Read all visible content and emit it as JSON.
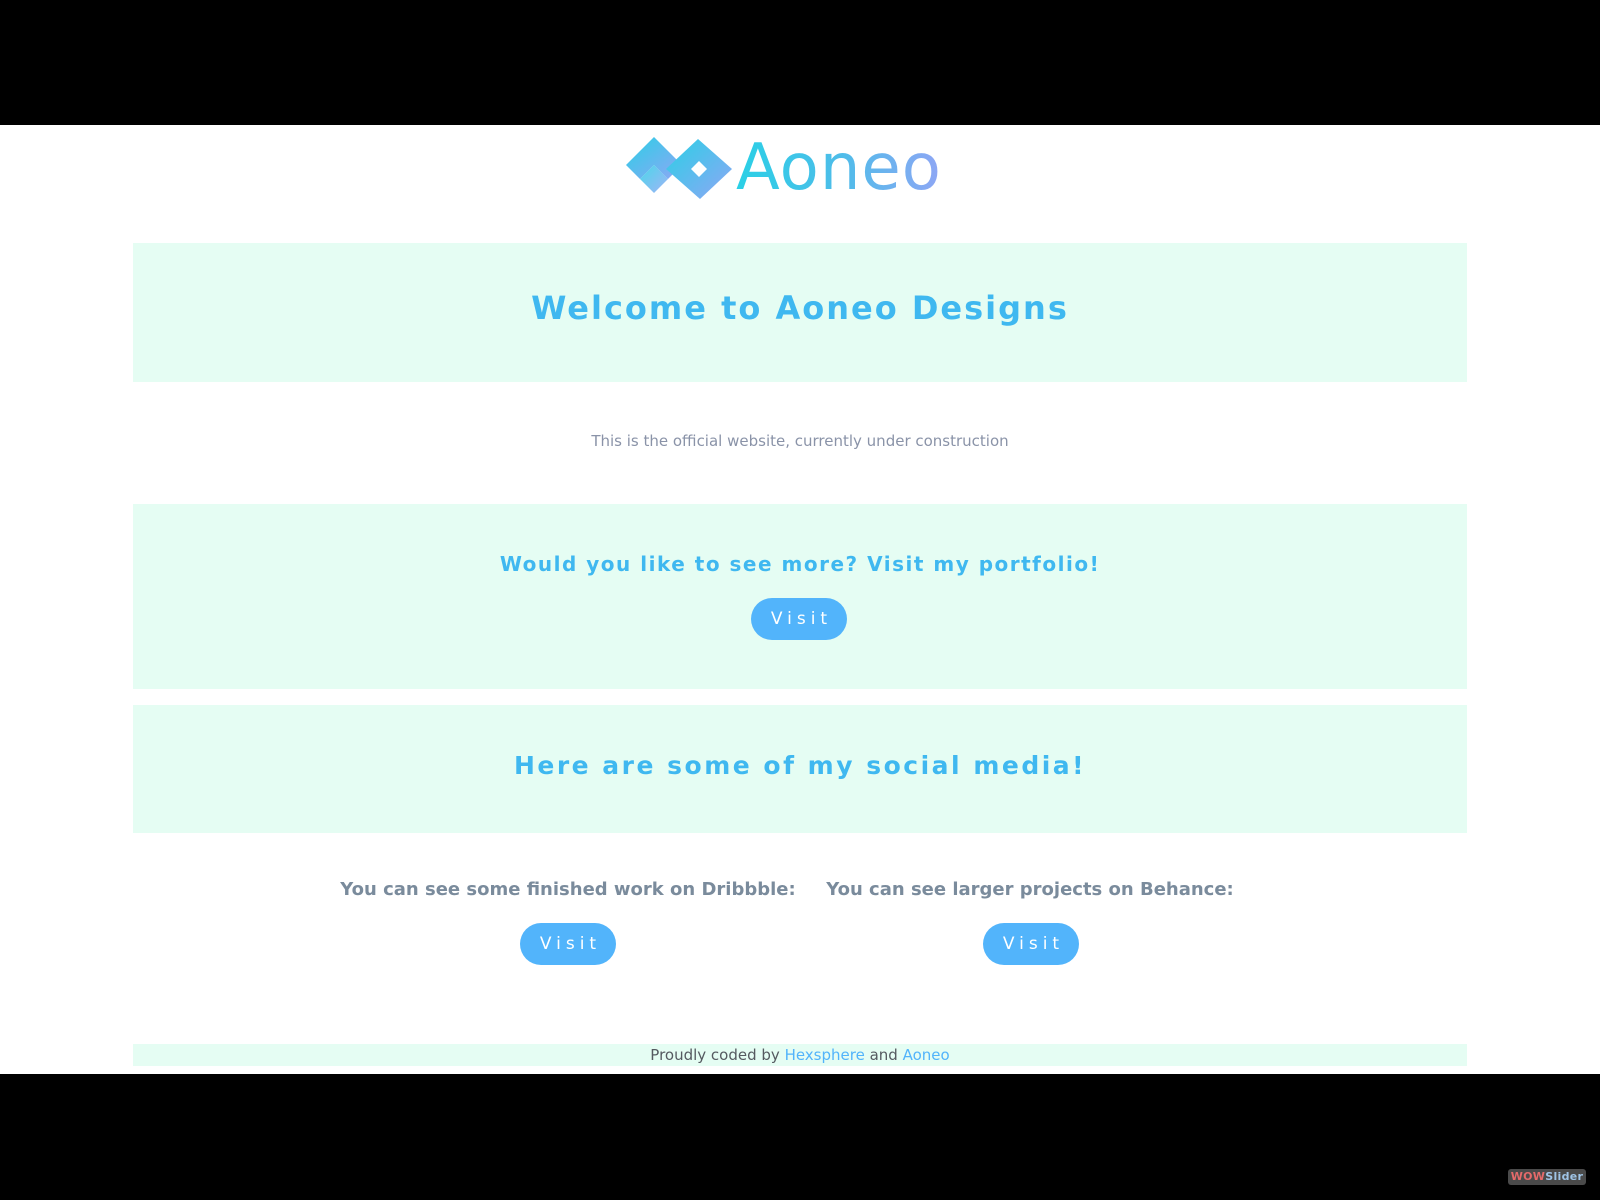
{
  "brand": {
    "name": "Aoneo",
    "gradient_start": "#2ad0e6",
    "gradient_end": "#8fa6f5"
  },
  "hero": {
    "title": "Welcome to Aoneo Designs"
  },
  "subtitle": "This is the official website, currently under construction",
  "portfolio": {
    "title": "Would you like to see more? Visit my portfolio!",
    "button_label": "Visit"
  },
  "social": {
    "title": "Here are some of my social media!",
    "dribbble": {
      "text": "You can see some finished work on Dribbble:",
      "button_label": "Visit"
    },
    "behance": {
      "text": "You can see larger projects on Behance:",
      "button_label": "Visit"
    }
  },
  "footer": {
    "prefix": "Proudly coded by",
    "link1": "Hexsphere",
    "joiner": "and",
    "link2": "Aoneo"
  },
  "watermark": {
    "part1": "WOW",
    "part2": "Slider"
  },
  "colors": {
    "accent": "#52b4fb",
    "heading": "#3fb8f0",
    "band": "#e5fdf3",
    "letterbox": "#000000"
  }
}
